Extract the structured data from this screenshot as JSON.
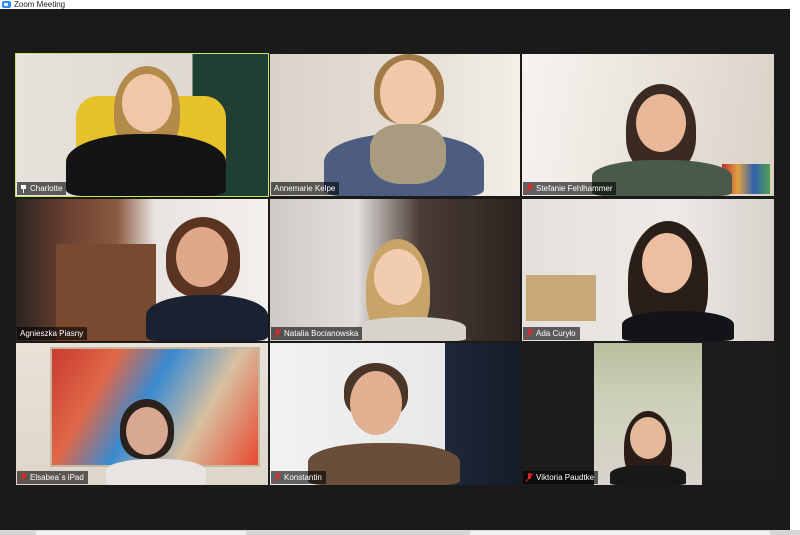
{
  "window": {
    "title": "Zoom Meeting",
    "app_icon": "zoom-camera-icon"
  },
  "colors": {
    "active_speaker_border": "#c6e85a",
    "muted_mic": "#e02828",
    "stage_bg": "#1a1a1a"
  },
  "participants": [
    {
      "name": "Charlotte",
      "status_icon": "pin-icon",
      "active": true
    },
    {
      "name": "Annemarie Kelpe",
      "status_icon": null,
      "active": false
    },
    {
      "name": "Stefanie Fehlhammer",
      "status_icon": "mic-muted-icon",
      "active": false
    },
    {
      "name": "Agnieszka Piasny",
      "status_icon": null,
      "active": false
    },
    {
      "name": "Natalia Bocianowska",
      "status_icon": "mic-muted-icon",
      "active": false
    },
    {
      "name": "Ada Curyło",
      "status_icon": "mic-muted-icon",
      "active": false
    },
    {
      "name": "Elsabea´s iPad",
      "status_icon": "mic-muted-icon",
      "active": false
    },
    {
      "name": "Konstantin",
      "status_icon": "mic-muted-icon",
      "active": false
    },
    {
      "name": "Viktoria Paudtke",
      "status_icon": "mic-muted-icon",
      "active": false
    }
  ]
}
